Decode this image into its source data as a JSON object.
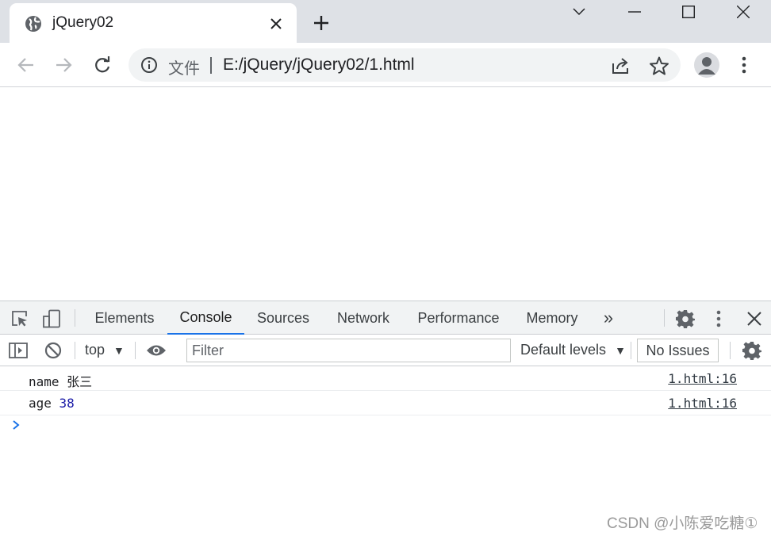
{
  "browser": {
    "tab": {
      "title": "jQuery02"
    },
    "omnibox": {
      "file_label": "文件",
      "url": "E:/jQuery/jQuery02/1.html"
    },
    "icons": [
      "globe-icon",
      "close-icon",
      "plus-icon",
      "chevron-down-icon",
      "minimize-icon",
      "maximize-icon",
      "close-window-icon",
      "back-arrow-icon",
      "forward-arrow-icon",
      "reload-icon",
      "info-icon",
      "share-icon",
      "star-icon",
      "profile-icon",
      "more-vert-icon"
    ]
  },
  "devtools": {
    "tabs": [
      {
        "label": "Elements",
        "active": false
      },
      {
        "label": "Console",
        "active": true
      },
      {
        "label": "Sources",
        "active": false
      },
      {
        "label": "Network",
        "active": false
      },
      {
        "label": "Performance",
        "active": false
      },
      {
        "label": "Memory",
        "active": false
      }
    ],
    "more_tabs": "»",
    "toolbar": {
      "context": "top",
      "filter_placeholder": "Filter",
      "levels": "Default levels",
      "issues": "No Issues"
    },
    "console": {
      "rows": [
        {
          "key": "name",
          "value": "张三",
          "value_is_number": false,
          "source": "1.html:16"
        },
        {
          "key": "age",
          "value": "38",
          "value_is_number": true,
          "source": "1.html:16"
        }
      ]
    },
    "colors": {
      "accent": "#1a73e8",
      "number": "#1a1aa6"
    }
  },
  "watermark": "CSDN @小陈爱吃糖①"
}
